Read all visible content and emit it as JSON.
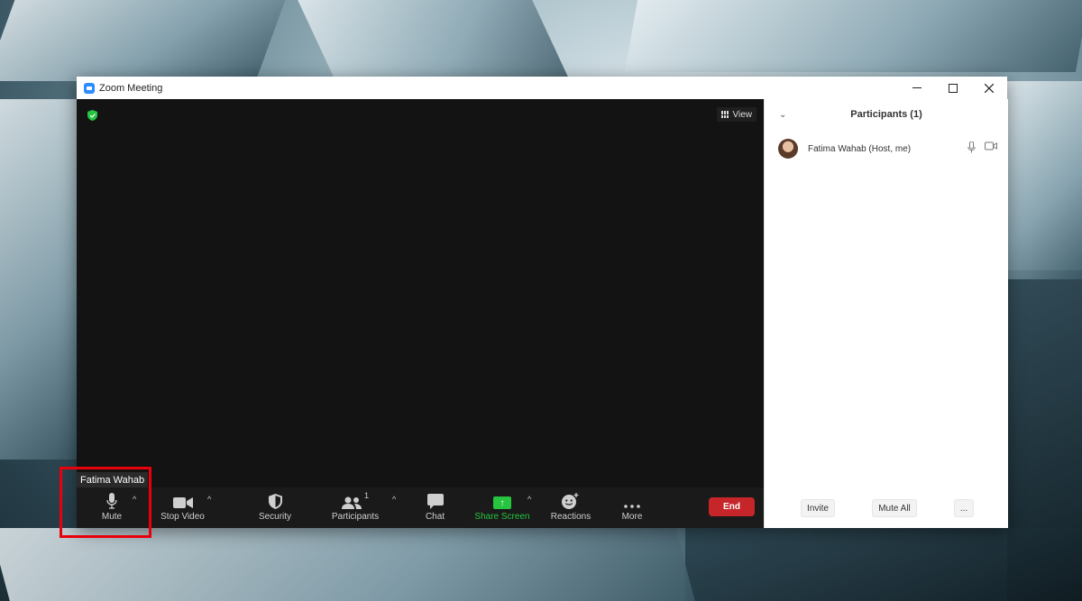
{
  "window": {
    "title": "Zoom Meeting",
    "controls": {
      "minimize": "—",
      "maximize": "☐",
      "close": "✕"
    }
  },
  "video": {
    "view_label": "View"
  },
  "tooltip": {
    "text": "Fatima Wahab"
  },
  "toolbar": {
    "mute_label": "Mute",
    "stop_video_label": "Stop Video",
    "security_label": "Security",
    "participants_label": "Participants",
    "participants_count": "1",
    "chat_label": "Chat",
    "share_screen_label": "Share Screen",
    "reactions_label": "Reactions",
    "more_label": "More",
    "end_label": "End"
  },
  "panel": {
    "title": "Participants (1)",
    "participants": [
      {
        "name": "Fatima Wahab (Host, me)"
      }
    ],
    "footer": {
      "invite_label": "Invite",
      "mute_all_label": "Mute All",
      "more_label": "..."
    }
  },
  "colors": {
    "accent": "#2d8cff",
    "share_green": "#27c440",
    "end_red": "#c6262a",
    "highlight_red": "#e8000b"
  }
}
